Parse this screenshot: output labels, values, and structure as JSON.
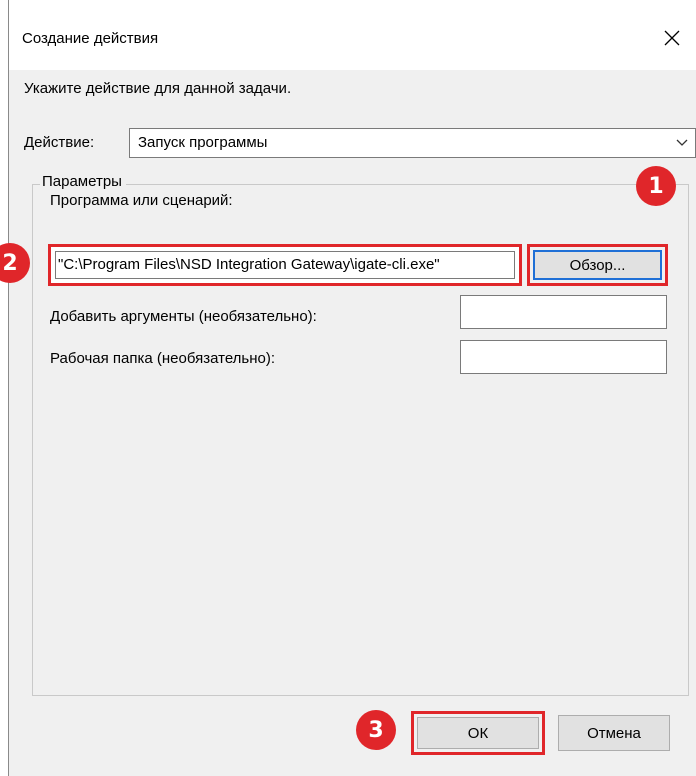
{
  "window": {
    "title": "Создание действия",
    "close_glyph": "✕"
  },
  "instruction": "Укажите действие для данной задачи.",
  "action": {
    "label": "Действие:",
    "selected": "Запуск программы"
  },
  "params": {
    "legend": "Параметры",
    "program_label": "Программа или сценарий:",
    "program_value": "\"C:\\Program Files\\NSD Integration Gateway\\igate-cli.exe\"",
    "browse_label": "Обзор...",
    "args_label": "Добавить аргументы (необязательно):",
    "args_value": "",
    "dir_label": "Рабочая папка (необязательно):",
    "dir_value": ""
  },
  "buttons": {
    "ok": "ОК",
    "cancel": "Отмена"
  },
  "markers": {
    "one": "1",
    "two": "2",
    "three": "3"
  },
  "colors": {
    "highlight": "#e0262a",
    "focus": "#1e6fd6"
  }
}
